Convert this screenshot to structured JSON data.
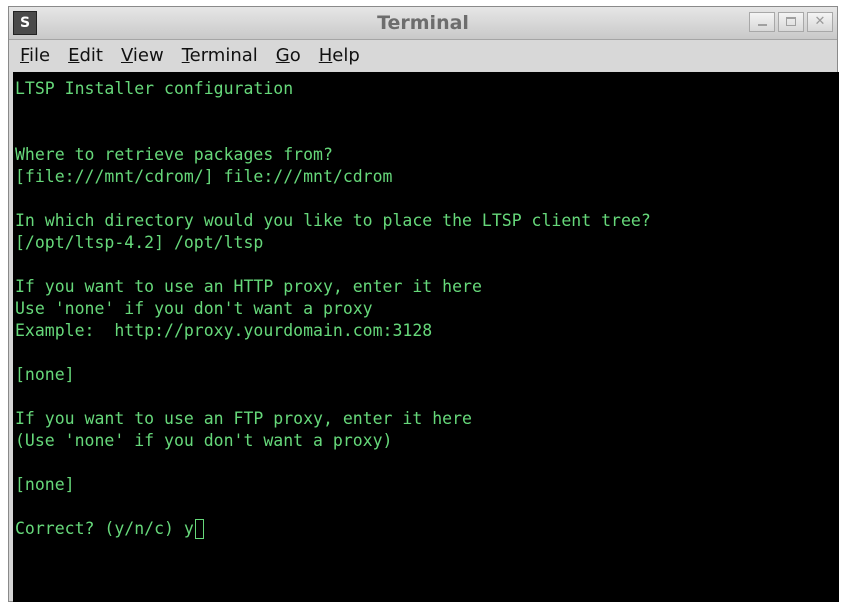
{
  "window": {
    "title": "Terminal",
    "icon_glyph": "S",
    "buttons": {
      "minimize": "minimize",
      "maximize": "maximize",
      "close": "✕"
    }
  },
  "menubar": {
    "items": [
      {
        "first": "F",
        "rest": "ile"
      },
      {
        "first": "E",
        "rest": "dit"
      },
      {
        "first": "V",
        "rest": "iew"
      },
      {
        "first": "T",
        "rest": "erminal"
      },
      {
        "first": "G",
        "rest": "o"
      },
      {
        "first": "H",
        "rest": "elp"
      }
    ]
  },
  "terminal": {
    "lines": [
      "LTSP Installer configuration",
      "",
      "",
      "Where to retrieve packages from?",
      "[file:///mnt/cdrom/] file:///mnt/cdrom",
      "",
      "In which directory would you like to place the LTSP client tree?",
      "[/opt/ltsp-4.2] /opt/ltsp",
      "",
      "If you want to use an HTTP proxy, enter it here",
      "Use 'none' if you don't want a proxy",
      "Example:  http://proxy.yourdomain.com:3128",
      "",
      "[none]",
      "",
      "If you want to use an FTP proxy, enter it here",
      "(Use 'none' if you don't want a proxy)",
      "",
      "[none]",
      "",
      "Correct? (y/n/c) y"
    ]
  },
  "colors": {
    "terminal_background": "#000000",
    "terminal_foreground": "#66d87a"
  }
}
